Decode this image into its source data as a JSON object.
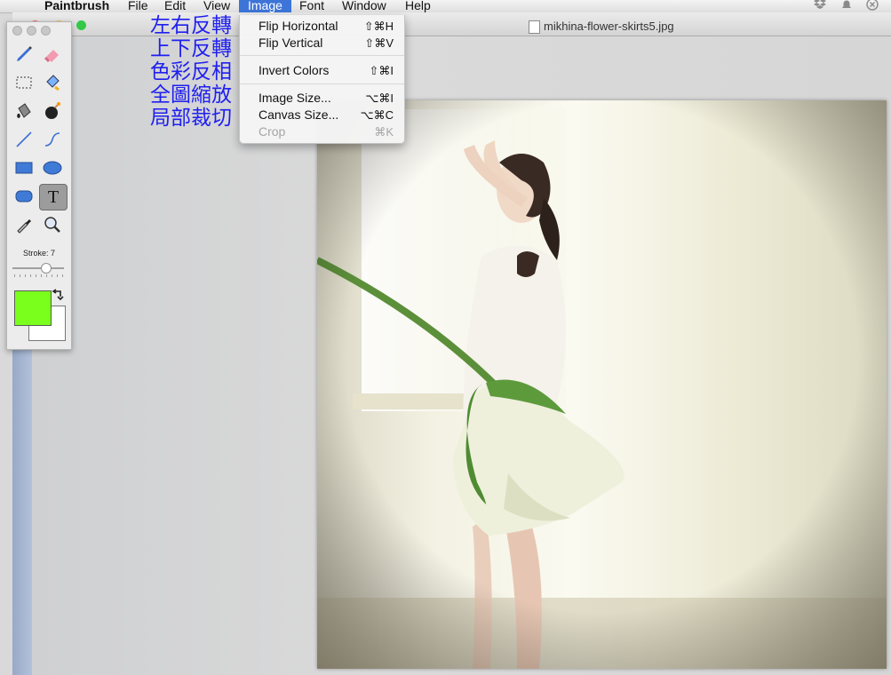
{
  "menubar": {
    "app_name": "Paintbrush",
    "items": [
      "File",
      "Edit",
      "View",
      "Image",
      "Font",
      "Window",
      "Help"
    ],
    "active": "Image"
  },
  "window": {
    "title": "mikhina-flower-skirts5.jpg"
  },
  "annotations": [
    "左右反轉",
    "上下反轉",
    "色彩反相",
    "全圖縮放",
    "局部裁切"
  ],
  "image_menu": {
    "groups": [
      [
        {
          "label": "Flip Horizontal",
          "shortcut": "⇧⌘H",
          "enabled": true
        },
        {
          "label": "Flip Vertical",
          "shortcut": "⇧⌘V",
          "enabled": true
        }
      ],
      [
        {
          "label": "Invert Colors",
          "shortcut": "⇧⌘I",
          "enabled": true
        }
      ],
      [
        {
          "label": "Image Size...",
          "shortcut": "⌥⌘I",
          "enabled": true
        },
        {
          "label": "Canvas Size...",
          "shortcut": "⌥⌘C",
          "enabled": true
        },
        {
          "label": "Crop",
          "shortcut": "⌘K",
          "enabled": false
        }
      ]
    ]
  },
  "palette": {
    "tools": [
      "brush-tool",
      "eraser-tool",
      "selection-tool",
      "fill-tool",
      "airbrush-tool",
      "bomb-tool",
      "line-tool",
      "curve-tool",
      "rectangle-tool",
      "ellipse-tool",
      "rounded-rect-tool",
      "text-tool",
      "eyedropper-tool",
      "zoom-tool"
    ],
    "selected_tool": "text-tool",
    "text_tool_glyph": "T",
    "stroke_label": "Stroke: 7",
    "stroke_value": 7,
    "foreground_color": "#7aff1d",
    "background_color": "#ffffff"
  },
  "colors": {
    "menu_highlight": "#3d74d8",
    "annotation_text": "#1f1ff0"
  }
}
